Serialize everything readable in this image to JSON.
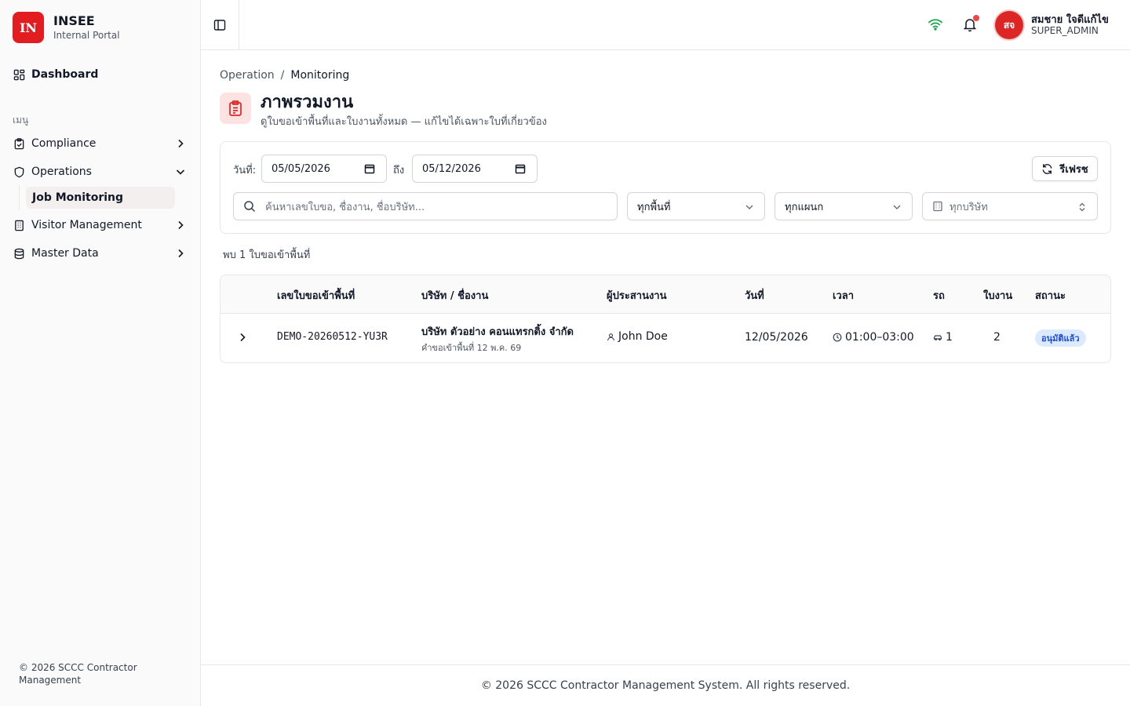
{
  "brand": {
    "logo": "IN",
    "name": "INSEE",
    "subtitle": "Internal Portal"
  },
  "sidebar": {
    "dashboard": "Dashboard",
    "section_label": "เมนู",
    "items": [
      {
        "label": "Compliance",
        "icon": "clipboard-check-icon"
      },
      {
        "label": "Operations",
        "icon": "shield-icon",
        "expanded": true
      },
      {
        "label": "Visitor Management",
        "icon": "building-icon"
      },
      {
        "label": "Master Data",
        "icon": "database-icon"
      }
    ],
    "sub_items": [
      "Job Monitoring"
    ],
    "footer": "© 2026 SCCC Contractor Management"
  },
  "header": {
    "avatar_initials": "สจ",
    "user_name": "สมชาย ใจดีแก้ไข",
    "user_role": "SUPER_ADMIN"
  },
  "breadcrumb": {
    "parent": "Operation",
    "separator": "/",
    "current": "Monitoring"
  },
  "page": {
    "title": "ภาพรวมงาน",
    "subtitle": "ดูใบขอเข้าพื้นที่และใบงานทั้งหมด — แก้ไขได้เฉพาะใบที่เกี่ยวข้อง"
  },
  "filters": {
    "date_label": "วันที่:",
    "to_label": "ถึง",
    "date_from": "05/05/2026",
    "date_to": "05/12/2026",
    "refresh_label": "รีเฟรช",
    "search_placeholder": "ค้นหาเลขใบขอ, ชื่องาน, ชื่อบริษัท...",
    "area": "ทุกพื้นที่",
    "department": "ทุกแผนก",
    "company": "ทุกบริษัท"
  },
  "results_text": "พบ 1 ใบขอเข้าพื้นที่",
  "table": {
    "headers": [
      "เลขใบขอเข้าพื้นที่",
      "บริษัท / ชื่องาน",
      "ผู้ประสานงาน",
      "วันที่",
      "เวลา",
      "รถ",
      "ใบงาน",
      "สถานะ"
    ],
    "rows": [
      {
        "request_no": "DEMO-20260512-YU3R",
        "company": "บริษัท ตัวอย่าง คอนแทรกติ้ง จำกัด",
        "job": "คำขอเข้าพื้นที่ 12 พ.ค. 69",
        "coordinator": "John Doe",
        "date": "12/05/2026",
        "time": "01:00–03:00",
        "vehicles": "1",
        "work_orders": "2",
        "status": "อนุมัติแล้ว"
      }
    ]
  },
  "footer": "© 2026 SCCC Contractor Management System. All rights reserved.",
  "colors": {
    "brand": "#e11d22",
    "status_badge_bg": "#dbeafe",
    "status_badge_text": "#1d4ed8",
    "wifi": "#16a34a"
  }
}
